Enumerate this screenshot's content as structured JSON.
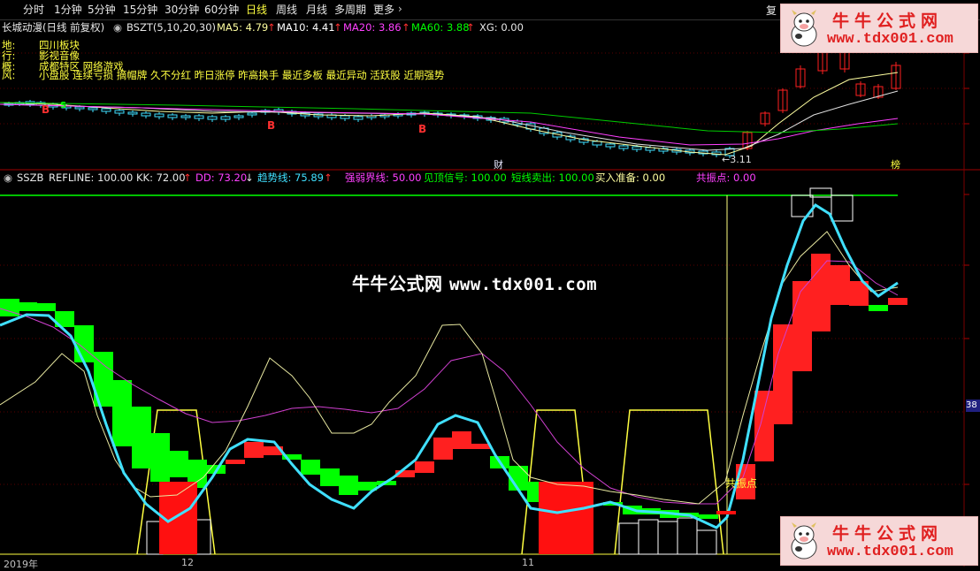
{
  "periods": [
    {
      "label": "分时",
      "selected": false
    },
    {
      "label": "1分钟",
      "selected": false
    },
    {
      "label": "5分钟",
      "selected": false
    },
    {
      "label": "15分钟",
      "selected": false
    },
    {
      "label": "30分钟",
      "selected": false
    },
    {
      "label": "60分钟",
      "selected": false
    },
    {
      "label": "日线",
      "selected": true
    },
    {
      "label": "周线",
      "selected": false
    },
    {
      "label": "月线",
      "selected": false
    },
    {
      "label": "多周期",
      "selected": false
    },
    {
      "label": "更多",
      "selected": false
    }
  ],
  "topbar_right": "复",
  "upper_panel": {
    "stock_title": "长城动漫(日线 前复权)",
    "indicator_name": "BSZT(5,10,20,30)",
    "ma5": "MA5: 4.79",
    "ma10": "MA10: 4.41",
    "ma20": "MA20: 3.86",
    "ma60": "MA60: 3.88",
    "xg": "XG: 0.00",
    "tags": [
      {
        "key": "地:",
        "value": "四川板块"
      },
      {
        "key": "行:",
        "value": "影视音像"
      },
      {
        "key": "概:",
        "value": "成都特区 网络游戏"
      },
      {
        "key": "风:",
        "value": "小盘股 连续亏损 摘帽牌 久不分红 昨日涨停 昨高换手 最近多板 最近异动 活跃股 近期强势"
      }
    ],
    "marker_b": "B",
    "marker_s": "S",
    "label_cai": "财",
    "label_bang": "榜",
    "price_label": "3.11"
  },
  "lower_panel": {
    "indicator_name": "SSZB",
    "refline": "REFLINE: 100.00",
    "kk": "KK: 72.00",
    "dd": "DD: 73.20",
    "trend": "趋势线: 75.89",
    "strong_weak": "强弱界线: 50.00",
    "top_signal": "见顶信号: 100.00",
    "short_sell": "短线卖出: 100.00",
    "buy_ready": "买入准备: 0.00",
    "resonance": "共振点: 0.00",
    "resonance_label": "共振点",
    "side_value": "38"
  },
  "watermark": {
    "center_name": "牛牛公式网",
    "center_url": "www.tdx001.com",
    "logo_name": "牛牛公式网",
    "logo_url": "www.tdx001.com"
  },
  "axis": {
    "date1": "2019年",
    "date2": "12",
    "date3": "11"
  },
  "colors": {
    "up": "#ff2020",
    "down": "#00ff00",
    "trend": "#40e0ff",
    "ref": "#00ff00",
    "signal": "#ffff40",
    "magenta": "#ff40ff"
  }
}
